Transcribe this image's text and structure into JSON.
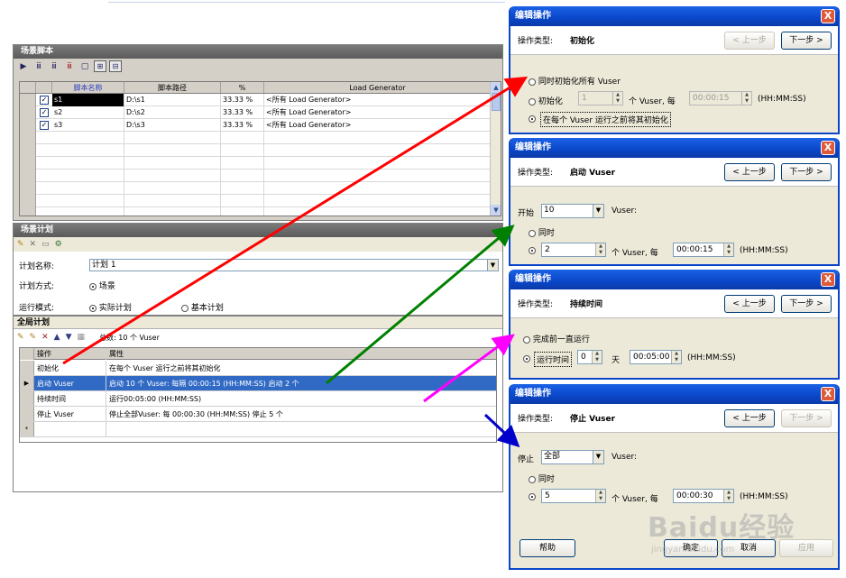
{
  "scripts_panel": {
    "title": "场景脚本",
    "toolbar_icons": [
      "run-icon",
      "vuser-icon",
      "vuser-add-icon",
      "vuser-remove-icon",
      "script-details-icon",
      "load-generator-icon",
      "refresh-icon"
    ],
    "columns": [
      "脚本名称",
      "脚本路径",
      "%",
      "Load Generator"
    ],
    "rows": [
      {
        "name": "s1",
        "path": "D:\\s1",
        "percent": "33.33 %",
        "generator": "<所有 Load Generator>"
      },
      {
        "name": "s2",
        "path": "D:\\s2",
        "percent": "33.33 %",
        "generator": "<所有 Load Generator>"
      },
      {
        "name": "s3",
        "path": "D:\\s3",
        "percent": "33.33 %",
        "generator": "<所有 Load Generator>"
      }
    ]
  },
  "schedule_panel": {
    "title": "场景计划",
    "plan_name_label": "计划名称:",
    "plan_name_value": "计划 1",
    "plan_mode_label": "计划方式:",
    "plan_mode_value": "场景",
    "run_mode_label": "运行模式:",
    "run_mode_real": "实际计划",
    "run_mode_basic": "基本计划"
  },
  "global_panel": {
    "title": "全局计划",
    "total": "总数: 10 个 Vuser",
    "col_action": "操作",
    "col_property": "属性",
    "rows": [
      {
        "action": "初始化",
        "property": "在每个 Vuser 运行之前将其初始化"
      },
      {
        "action": "启动 Vuser",
        "property": "启动 10 个 Vuser: 每隔 00:00:15 (HH:MM:SS) 启动 2 个"
      },
      {
        "action": "持续时间",
        "property": "运行00:05:00 (HH:MM:SS)"
      },
      {
        "action": "停止 Vuser",
        "property": "停止全部Vuser: 每 00:00:30 (HH:MM:SS) 停止 5 个"
      }
    ],
    "new_row_mark": "*"
  },
  "dialogs": {
    "common": {
      "title": "编辑操作",
      "op_type_label": "操作类型:",
      "prev": "< 上一步",
      "next": "下一步 >",
      "close": "X"
    },
    "init": {
      "op_type": "初始化",
      "opt_all": "同时初始化所有 Vuser",
      "opt_init": "初始化",
      "init_count": "1",
      "vuser_every": "个 Vuser, 每",
      "init_time": "00:00:15",
      "time_fmt": "(HH:MM:SS)",
      "opt_each": "在每个 Vuser 运行之前将其初始化"
    },
    "start": {
      "op_type": "启动 Vuser",
      "start_label": "开始",
      "start_value": "10",
      "vuser_colon": "Vuser:",
      "opt_simul": "同时",
      "count": "2",
      "vuser_every": "个 Vuser, 每",
      "time": "00:00:15",
      "time_fmt": "(HH:MM:SS)"
    },
    "duration": {
      "op_type": "持续时间",
      "opt_until": "完成前一直运行",
      "opt_run": "运行时间",
      "days": "0",
      "days_unit": "天",
      "time": "00:05:00",
      "time_fmt": "(HH:MM:SS)"
    },
    "stop": {
      "op_type": "停止 Vuser",
      "stop_label": "停止",
      "stop_value": "全部",
      "vuser_colon": "Vuser:",
      "opt_simul": "同时",
      "count": "5",
      "vuser_every": "个 Vuser, 每",
      "time": "00:00:30",
      "time_fmt": "(HH:MM:SS)",
      "help": "帮助",
      "ok": "确定",
      "cancel": "取消",
      "apply": "应用"
    }
  },
  "watermark": {
    "logo": "Baidu经验",
    "url": "jingyan.baidu.com"
  },
  "arrow_colors": {
    "init": "#ff0000",
    "start": "#008000",
    "duration": "#ff00ff",
    "stop": "#0000cc"
  }
}
